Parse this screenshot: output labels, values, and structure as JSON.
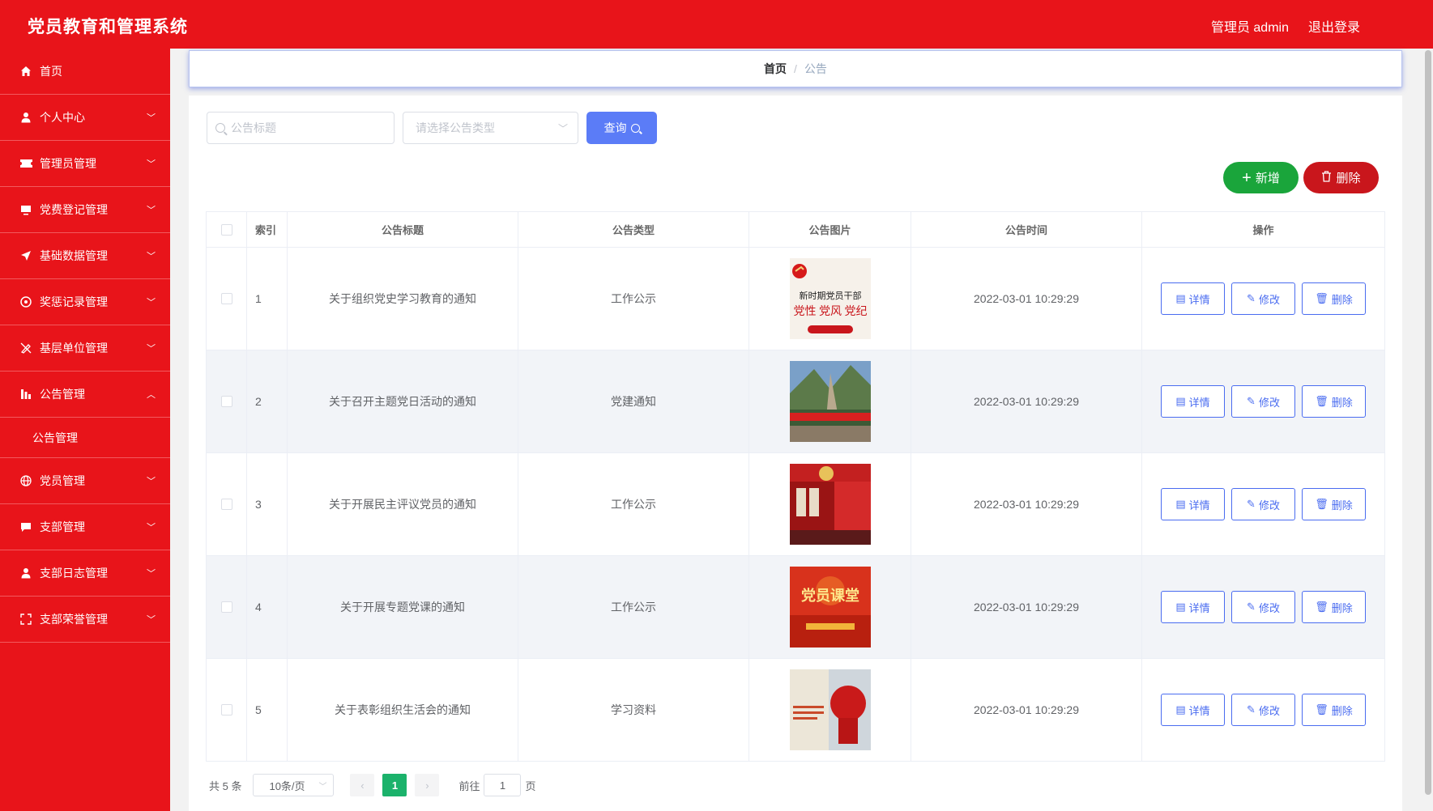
{
  "app": {
    "title": "党员教育和管理系统",
    "user": "管理员 admin",
    "logout": "退出登录"
  },
  "sidebar": {
    "items": [
      {
        "label": "首页",
        "icon": "home-icon"
      },
      {
        "label": "个人中心",
        "icon": "user-icon"
      },
      {
        "label": "管理员管理",
        "icon": "ticket-icon"
      },
      {
        "label": "党费登记管理",
        "icon": "monitor-icon"
      },
      {
        "label": "基础数据管理",
        "icon": "send-icon"
      },
      {
        "label": "奖惩记录管理",
        "icon": "compass-icon"
      },
      {
        "label": "基层单位管理",
        "icon": "no-edit-icon"
      },
      {
        "label": "公告管理",
        "icon": "chart-icon"
      },
      {
        "label": "党员管理",
        "icon": "globe-icon"
      },
      {
        "label": "支部管理",
        "icon": "chat-icon"
      },
      {
        "label": "支部日志管理",
        "icon": "user-icon"
      },
      {
        "label": "支部荣誉管理",
        "icon": "fullscreen-icon"
      }
    ],
    "submenu": "公告管理"
  },
  "breadcrumb": {
    "home": "首页",
    "sep": "/",
    "current": "公告"
  },
  "search": {
    "title_placeholder": "公告标题",
    "type_placeholder": "请选择公告类型",
    "query_label": "查询"
  },
  "actions": {
    "add": "新增",
    "delete": "删除"
  },
  "table": {
    "headers": {
      "index": "索引",
      "title": "公告标题",
      "type": "公告类型",
      "image": "公告图片",
      "time": "公告时间",
      "ops": "操作"
    },
    "ops": {
      "detail": "详情",
      "edit": "修改",
      "delete": "删除"
    },
    "rows": [
      {
        "index": "1",
        "title": "关于组织党史学习教育的通知",
        "type": "工作公示",
        "time": "2022-03-01 10:29:29",
        "image_text": [
          "新时期党员干部",
          "党性 党风 党纪"
        ]
      },
      {
        "index": "2",
        "title": "关于召开主题党日活动的通知",
        "type": "党建通知",
        "time": "2022-03-01 10:29:29",
        "image_text": []
      },
      {
        "index": "3",
        "title": "关于开展民主评议党员的通知",
        "type": "工作公示",
        "time": "2022-03-01 10:29:29",
        "image_text": []
      },
      {
        "index": "4",
        "title": "关于开展专题党课的通知",
        "type": "工作公示",
        "time": "2022-03-01 10:29:29",
        "image_text": [
          "党员课堂"
        ]
      },
      {
        "index": "5",
        "title": "关于表彰组织生活会的通知",
        "type": "学习资料",
        "time": "2022-03-01 10:29:29",
        "image_text": []
      }
    ]
  },
  "pagination": {
    "total": "共 5 条",
    "page_size": "10条/页",
    "current": "1",
    "goto_prefix": "前往",
    "goto_value": "1",
    "goto_suffix": "页"
  },
  "colors": {
    "brand": "#e8141a",
    "primary": "#5b7cf7",
    "success": "#1aa53b",
    "danger": "#c9161c",
    "page_active": "#1bb26b"
  }
}
